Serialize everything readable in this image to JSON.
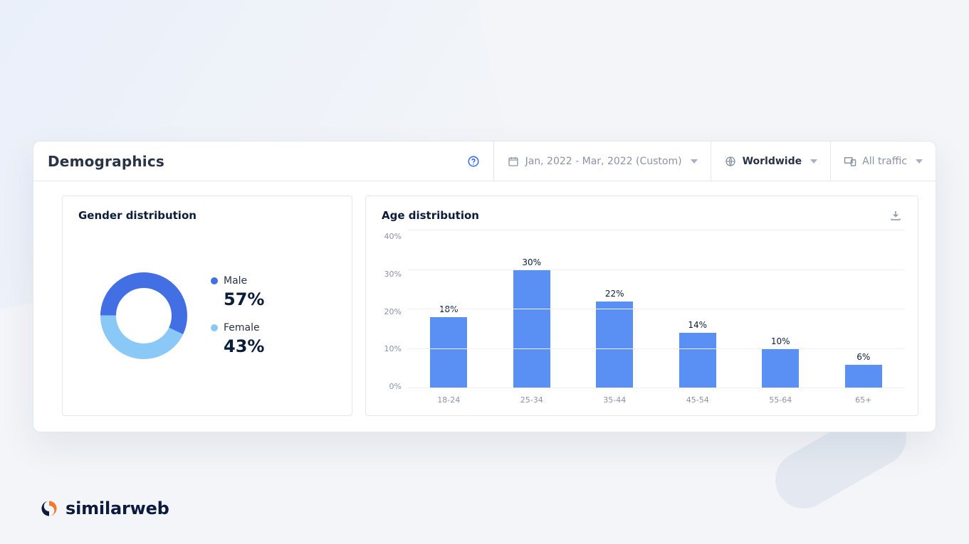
{
  "header": {
    "title": "Demographics",
    "date_range": "Jan, 2022 - Mar, 2022 (Custom)",
    "region": "Worldwide",
    "traffic": "All traffic"
  },
  "panels": {
    "gender": {
      "title": "Gender distribution",
      "male_label": "Male",
      "male_value": "57%",
      "female_label": "Female",
      "female_value": "43%"
    },
    "age": {
      "title": "Age distribution"
    }
  },
  "brand": {
    "name": "similarweb"
  },
  "colors": {
    "male": "#436fe5",
    "female": "#8ac8f8",
    "bar": "#5a8ff4"
  },
  "chart_data": [
    {
      "type": "pie",
      "title": "Gender distribution",
      "series": [
        {
          "name": "Male",
          "value": 57,
          "color": "#436fe5"
        },
        {
          "name": "Female",
          "value": 43,
          "color": "#8ac8f8"
        }
      ]
    },
    {
      "type": "bar",
      "title": "Age distribution",
      "categories": [
        "18-24",
        "25-34",
        "35-44",
        "45-54",
        "55-64",
        "65+"
      ],
      "values": [
        18,
        30,
        22,
        14,
        10,
        6
      ],
      "xlabel": "",
      "ylabel": "",
      "ylim": [
        0,
        40
      ],
      "yticks": [
        0,
        10,
        20,
        30,
        40
      ],
      "value_suffix": "%"
    }
  ]
}
